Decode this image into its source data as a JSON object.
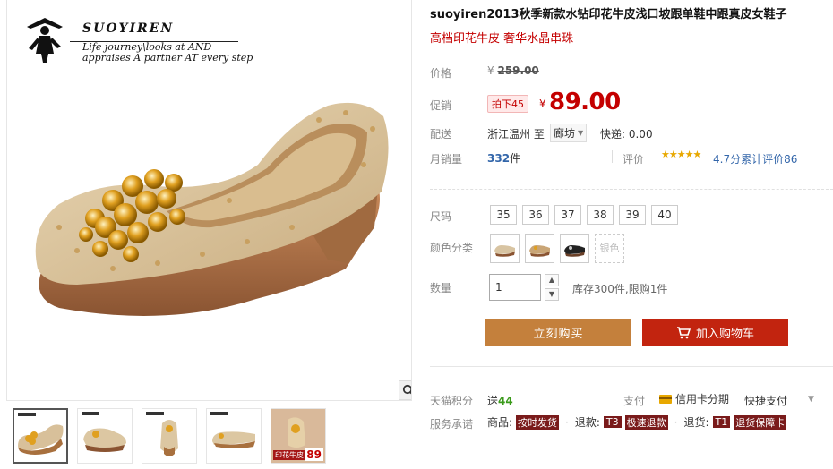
{
  "brand": {
    "name": "SUOYIREN",
    "tagline_1": "Life journey\\looks at AND",
    "tagline_2": "appraises A partner AT every step"
  },
  "product": {
    "title": "suoyiren2013秋季新款水钻印花牛皮浅口坡跟单鞋中跟真皮女鞋子",
    "subtitle": "高档印花牛皮 奢华水晶串珠"
  },
  "pricing": {
    "price_label": "价格",
    "orig_currency": "¥",
    "orig_price": "259.00",
    "promo_label": "促销",
    "promo_badge": "拍下45",
    "promo_currency": "¥",
    "promo_price": "89.00"
  },
  "shipping": {
    "label": "配送",
    "from": "浙江温州 至",
    "to": "廊坊",
    "express": "快递: 0.00"
  },
  "sales": {
    "label": "月销量",
    "count": "332",
    "unit": "件",
    "review_label": "评价",
    "stars": "★★★★★",
    "review_text": "4.7分累计评价86"
  },
  "options": {
    "size_label": "尺码",
    "sizes": [
      "35",
      "36",
      "37",
      "38",
      "39",
      "40"
    ],
    "color_label": "颜色分类",
    "disabled_color": "银色",
    "qty_label": "数量",
    "qty_value": "1",
    "stock_text": "库存300件,限购1件"
  },
  "actions": {
    "buy_now": "立刻购买",
    "add_cart": "加入购物车"
  },
  "extras": {
    "points_label": "天猫积分",
    "points_prefix": "送",
    "points_value": "44",
    "pay_label": "支付",
    "pay_card": "信用卡分期",
    "pay_fast": "快捷支付",
    "promise_label": "服务承诺",
    "promise_goods": "商品:",
    "promise_goods_tag": "按时发货",
    "promise_refund": "退款:",
    "promise_refund_box": "T3",
    "promise_refund_tag": "极速退款",
    "promise_return": "退货:",
    "promise_return_box": "T1",
    "promise_return_tag": "退货保障卡"
  },
  "thumb5": {
    "tag": "印花牛皮",
    "price": "89"
  },
  "colors": {
    "promo_red": "#c40000",
    "buy_now_bg": "#c4803c",
    "add_cart_bg": "#c2240f",
    "link_blue": "#3366aa"
  },
  "icons": [
    "search-icon",
    "cart-icon",
    "chevron-down-icon",
    "star-icon",
    "credit-card-icon"
  ]
}
